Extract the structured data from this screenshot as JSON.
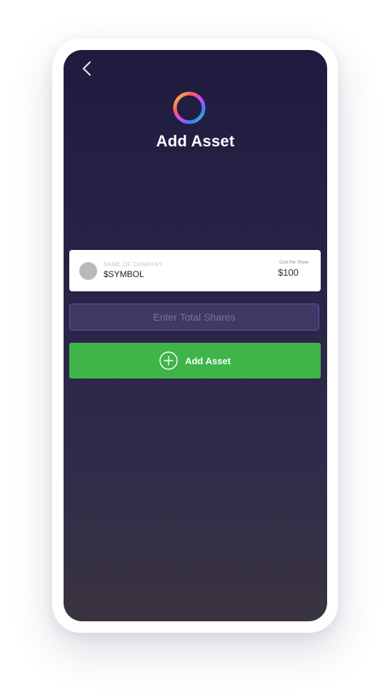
{
  "header": {
    "title": "Add Asset",
    "back_icon": "chevron-left-icon",
    "logo_icon": "rainbow-ring-logo"
  },
  "company_card": {
    "name_label": "NAME OF COMPANY",
    "symbol": "$SYMBOL",
    "cost_label": "Cost Per Share",
    "cost_value": "$100"
  },
  "shares_input": {
    "value": "",
    "placeholder": "Enter Total Shares"
  },
  "add_button": {
    "label": "Add Asset",
    "icon": "plus-circle-icon",
    "color": "#3fb549"
  },
  "colors": {
    "background_top": "#1f1b3f",
    "background_bottom": "#39343f",
    "input_border": "#5c52b0"
  }
}
